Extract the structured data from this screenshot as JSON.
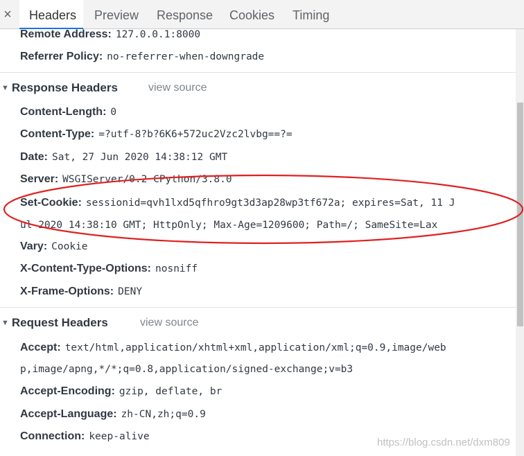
{
  "tabs": {
    "close_symbol": "×",
    "items": [
      "Headers",
      "Preview",
      "Response",
      "Cookies",
      "Timing"
    ],
    "active": "Headers"
  },
  "general": {
    "remote_address_name": "Remote Address:",
    "remote_address_value": "127.0.0.1:8000",
    "referrer_policy_name": "Referrer Policy:",
    "referrer_policy_value": "no-referrer-when-downgrade"
  },
  "response_headers": {
    "title": "Response Headers",
    "view_source": "view source",
    "items": [
      {
        "name": "Content-Length:",
        "value": "0"
      },
      {
        "name": "Content-Type:",
        "value": "=?utf-8?b?6K6+572uc2Vzc2lvbg==?="
      },
      {
        "name": "Date:",
        "value": "Sat, 27 Jun 2020 14:38:12 GMT"
      },
      {
        "name": "Server:",
        "value": "WSGIServer/0.2 CPython/3.8.0"
      },
      {
        "name": "Set-Cookie:",
        "value": "sessionid=qvh1lxd5qfhro9gt3d3ap28wp3tf672a; expires=Sat, 11 J",
        "continuation": "ul 2020 14:38:10 GMT; HttpOnly; Max-Age=1209600; Path=/; SameSite=Lax"
      },
      {
        "name": "Vary:",
        "value": "Cookie"
      },
      {
        "name": "X-Content-Type-Options:",
        "value": "nosniff"
      },
      {
        "name": "X-Frame-Options:",
        "value": "DENY"
      }
    ]
  },
  "request_headers": {
    "title": "Request Headers",
    "view_source": "view source",
    "items": [
      {
        "name": "Accept:",
        "value": "text/html,application/xhtml+xml,application/xml;q=0.9,image/web",
        "continuation": "p,image/apng,*/*;q=0.8,application/signed-exchange;v=b3"
      },
      {
        "name": "Accept-Encoding:",
        "value": "gzip, deflate, br"
      },
      {
        "name": "Accept-Language:",
        "value": "zh-CN,zh;q=0.9"
      },
      {
        "name": "Connection:",
        "value": "keep-alive"
      }
    ]
  },
  "icons": {
    "collapse_triangle": "▼"
  },
  "colors": {
    "annotation_ellipse": "#e02020",
    "active_tab_underline": "#1a73e8"
  },
  "watermark": "https://blog.csdn.net/dxm809"
}
